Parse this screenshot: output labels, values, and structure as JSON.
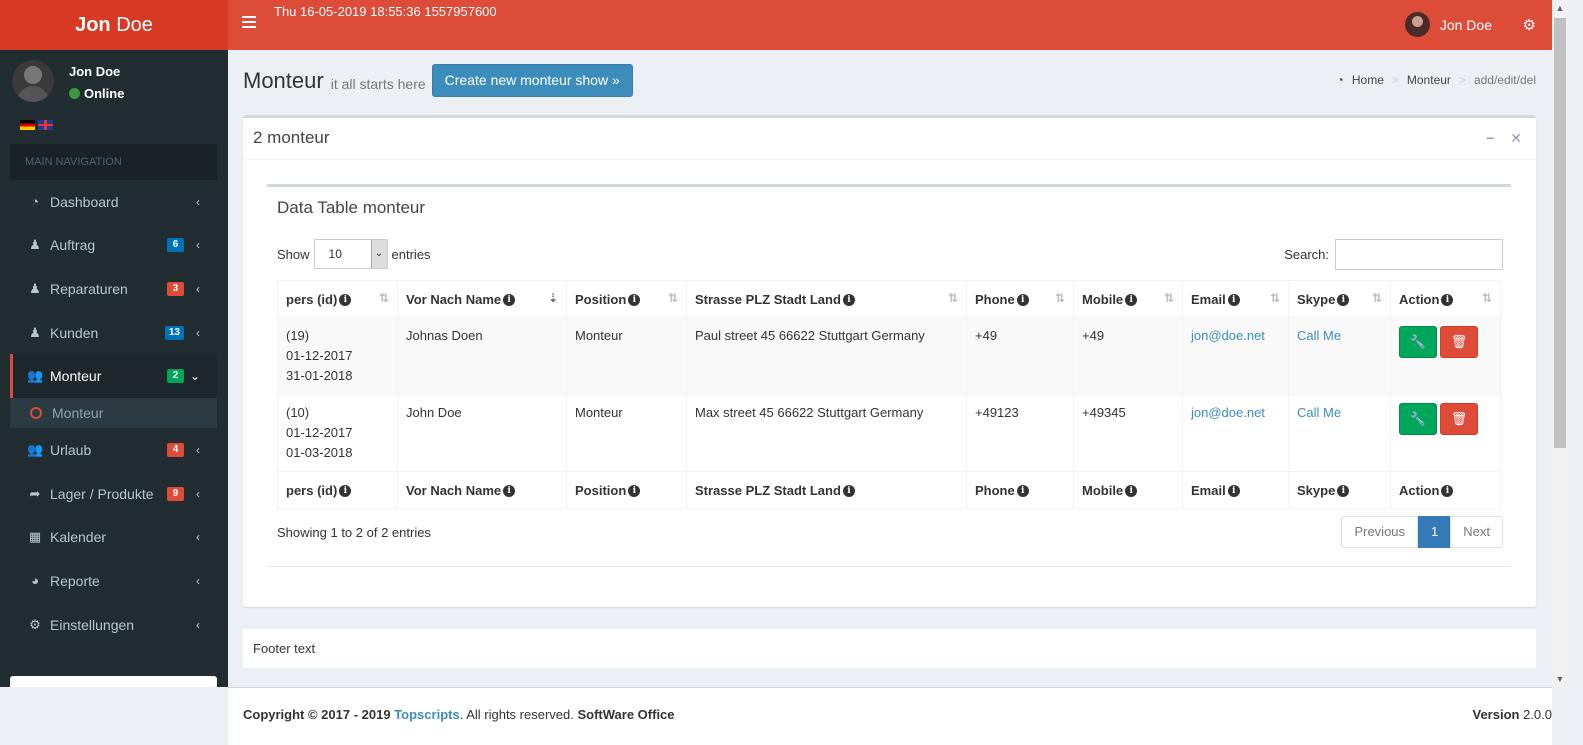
{
  "brand": {
    "first": "Jon",
    "second": "Doe"
  },
  "header": {
    "clock": "Thu 16-05-2019 18:55:36 1557957600",
    "user_name": "Jon Doe"
  },
  "sidebar": {
    "user_name": "Jon Doe",
    "status": "Online",
    "nav_header": "MAIN NAVIGATION",
    "items": [
      {
        "label": "Dashboard",
        "icon": "dashboard-icon"
      },
      {
        "label": "Auftrag",
        "icon": "person-icon",
        "badge": "6",
        "badge_color": "#0073b7"
      },
      {
        "label": "Reparaturen",
        "icon": "person-icon",
        "badge": "3",
        "badge_color": "#dd4b39"
      },
      {
        "label": "Kunden",
        "icon": "person-icon",
        "badge": "13",
        "badge_color": "#0073b7"
      },
      {
        "label": "Monteur",
        "icon": "users-icon",
        "badge": "2",
        "badge_color": "#00a65a"
      },
      {
        "label": "Urlaub",
        "icon": "users-icon",
        "badge": "4",
        "badge_color": "#dd4b39"
      },
      {
        "label": "Lager / Produkte",
        "icon": "share-icon",
        "badge": "9",
        "badge_color": "#dd4b39"
      },
      {
        "label": "Kalender",
        "icon": "calendar-icon"
      },
      {
        "label": "Reporte",
        "icon": "pie-chart-icon"
      },
      {
        "label": "Einstellungen",
        "icon": "gears-icon"
      }
    ],
    "submenu_label": "Monteur"
  },
  "content": {
    "title": "Monteur",
    "subtitle": "it all starts here",
    "create_button": "Create new monteur show »",
    "breadcrumb": [
      "Home",
      "Monteur",
      "add/edit/del"
    ],
    "box_title": "2 monteur",
    "table_title": "Data Table monteur",
    "show_label": "Show",
    "entries_label": "entries",
    "length_value": "10",
    "search_label": "Search:",
    "search_value": "",
    "columns": [
      "pers (id)",
      "Vor Nach Name",
      "Position",
      "Strasse PLZ Stadt Land",
      "Phone",
      "Mobile",
      "Email",
      "Skype",
      "Action"
    ],
    "rows": [
      {
        "id": "(19)",
        "start": "01-12-2017",
        "end": "31-01-2018",
        "name": "Johnas Doen",
        "position": "Monteur",
        "address": "Paul street 45 66622 Stuttgart Germany",
        "phone": "+49",
        "mobile": "+49",
        "email": "jon@doe.net",
        "skype": "Call Me"
      },
      {
        "id": "(10)",
        "start": "01-12-2017",
        "end": "01-03-2018",
        "name": "John Doe",
        "position": "Monteur",
        "address": "Max street 45 66622 Stuttgart Germany",
        "phone": "+49123",
        "mobile": "+49345",
        "email": "jon@doe.net",
        "skype": "Call Me"
      }
    ],
    "showing": "Showing 1 to 2 of 2 entries",
    "pager": {
      "prev": "Previous",
      "current": "1",
      "next": "Next"
    },
    "footer_text": "Footer text"
  },
  "footer": {
    "copy_prefix": "Copyright © 2017 - 2019",
    "company": "Topscripts",
    "rights": ". All rights reserved.",
    "product": "SoftWare Office",
    "version_label": "Version",
    "version": "2.0.0"
  },
  "colors": {
    "header": "#dd4b39",
    "logo": "#d73925",
    "sidebar": "#222d32",
    "primary": "#3c8dbc"
  }
}
